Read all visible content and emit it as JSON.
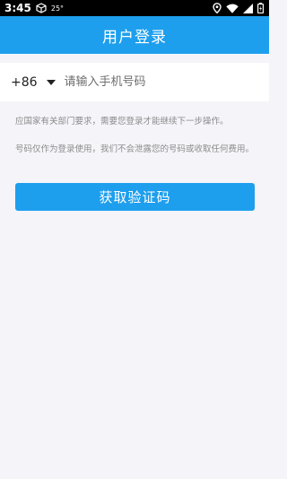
{
  "status_bar": {
    "time": "3:45",
    "temperature": "25°",
    "icons": [
      "cube-icon",
      "location-icon",
      "wifi-icon",
      "signal-icon",
      "battery-icon"
    ]
  },
  "app_bar": {
    "title": "用户登录"
  },
  "login_form": {
    "country_code": "+86",
    "phone_placeholder": "请输入手机号码",
    "phone_value": ""
  },
  "notices": {
    "line1": "应国家有关部门要求，需要您登录才能继续下一步操作。",
    "line2": "号码仅作为登录使用，我们不会泄露您的号码或收取任何费用。"
  },
  "actions": {
    "get_code_label": "获取验证码"
  },
  "colors": {
    "accent": "#1e9fee",
    "background": "#f4f4f9",
    "hint_text": "#8d8d8d"
  }
}
